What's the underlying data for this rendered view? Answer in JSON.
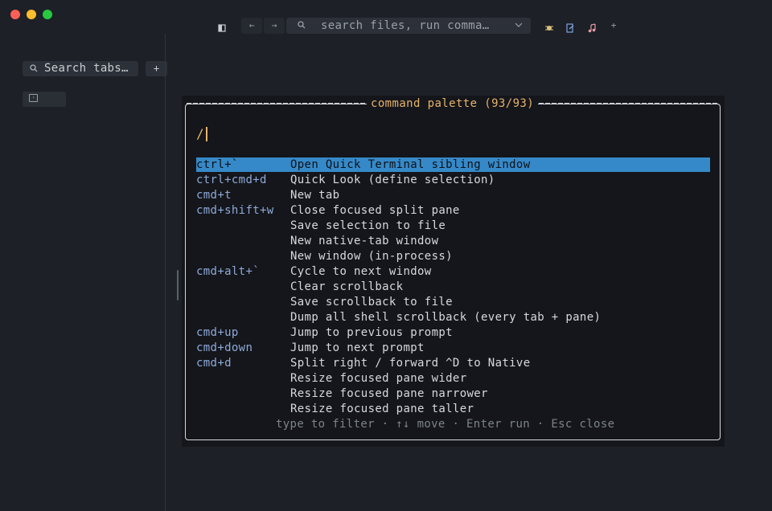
{
  "titlebar": {
    "command_placeholder": "search files, run comma…",
    "sidebar_toggle_icon": "sidebar-toggle-icon",
    "back_label": "←",
    "forward_label": "→",
    "new_label": "+"
  },
  "sidebar": {
    "search_placeholder": "Search tabs…",
    "add_label": "+"
  },
  "palette": {
    "title": "command palette (93/93)",
    "query": "/",
    "items": [
      {
        "key": "ctrl+`",
        "desc": "Open Quick Terminal sibling window",
        "selected": true
      },
      {
        "key": "ctrl+cmd+d",
        "desc": "Quick Look (define selection)"
      },
      {
        "key": "cmd+t",
        "desc": "New tab"
      },
      {
        "key": "cmd+shift+w",
        "desc": "Close focused split pane"
      },
      {
        "key": "",
        "desc": "Save selection to file"
      },
      {
        "key": "",
        "desc": "New native-tab window"
      },
      {
        "key": "",
        "desc": "New window (in-process)"
      },
      {
        "key": "cmd+alt+`",
        "desc": "Cycle to next window"
      },
      {
        "key": "",
        "desc": "Clear scrollback"
      },
      {
        "key": "",
        "desc": "Save scrollback to file"
      },
      {
        "key": "",
        "desc": "Dump all shell scrollback (every tab + pane)"
      },
      {
        "key": "cmd+up",
        "desc": "Jump to previous prompt"
      },
      {
        "key": "cmd+down",
        "desc": "Jump to next prompt"
      },
      {
        "key": "cmd+d",
        "desc": "Split right / forward ^D to Native"
      },
      {
        "key": "",
        "desc": "Resize focused pane wider"
      },
      {
        "key": "",
        "desc": "Resize focused pane narrower"
      },
      {
        "key": "",
        "desc": "Resize focused pane taller"
      }
    ],
    "hint": "type to filter · ↑↓ move · Enter run · Esc close"
  },
  "colors": {
    "selection": "#3689c8",
    "accent": "#e7b36a",
    "key": "#8fa9d8"
  }
}
